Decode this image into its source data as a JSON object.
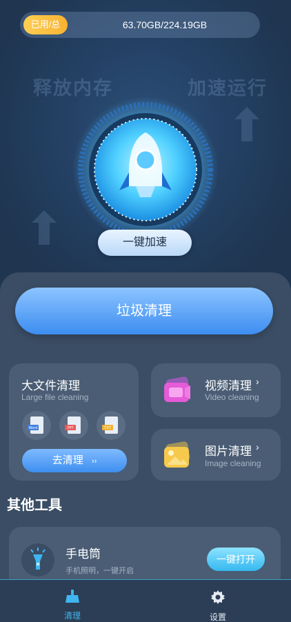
{
  "storage": {
    "tag": "已用/总",
    "value": "63.70GB/224.19GB"
  },
  "hero": {
    "ghost_left": "释放内存",
    "ghost_right": "加速运行",
    "accelerate_label": "一键加速"
  },
  "main": {
    "junk_clean_label": "垃圾清理"
  },
  "cards": {
    "large_file": {
      "title": "大文件清理",
      "subtitle": "Large file cleaning",
      "file_types": [
        "Word",
        "PPT",
        "TXT"
      ],
      "button": "去清理"
    },
    "video": {
      "title": "视频清理",
      "subtitle": "Video cleaning"
    },
    "image": {
      "title": "图片清理",
      "subtitle": "Image cleaning"
    }
  },
  "tools": {
    "section_title": "其他工具",
    "flashlight": {
      "title": "手电筒",
      "subtitle": "手机照明，一键开启",
      "button": "一键打开"
    }
  },
  "tabbar": {
    "items": [
      {
        "label": "清理",
        "icon": "broom-icon",
        "active": true
      },
      {
        "label": "设置",
        "icon": "gear-icon",
        "active": false
      }
    ]
  },
  "colors": {
    "accent_blue": "#3d8df0",
    "accent_cyan": "#35b8f0",
    "accent_yellow": "#f7b233"
  }
}
